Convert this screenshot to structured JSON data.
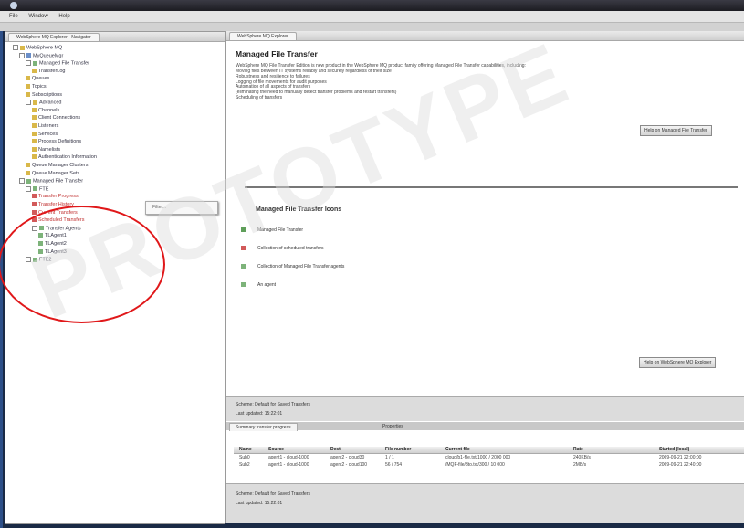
{
  "menu": [
    "File",
    "Window",
    "Help"
  ],
  "left_pane": {
    "tab": "WebSphere MQ Explorer - Navigator",
    "tree": [
      {
        "label": "WebSphere MQ",
        "depth": 0,
        "icon": "folder-icon",
        "expander": true
      },
      {
        "label": "MyQueueMgr",
        "depth": 1,
        "icon": "queue-manager-icon",
        "expander": true
      },
      {
        "label": "Managed File Transfer",
        "depth": 2,
        "icon": "agent-icon",
        "expander": true
      },
      {
        "label": "TransferLog",
        "depth": 3,
        "icon": "folder-icon"
      },
      {
        "label": "Queues",
        "depth": 2,
        "icon": "folder-icon"
      },
      {
        "label": "Topics",
        "depth": 2,
        "icon": "folder-icon"
      },
      {
        "label": "Subscriptions",
        "depth": 2,
        "icon": "folder-icon"
      },
      {
        "label": "Advanced",
        "depth": 2,
        "icon": "folder-icon",
        "expander": true
      },
      {
        "label": "Channels",
        "depth": 3,
        "icon": "folder-icon"
      },
      {
        "label": "Client Connections",
        "depth": 3,
        "icon": "folder-icon"
      },
      {
        "label": "Listeners",
        "depth": 3,
        "icon": "folder-icon"
      },
      {
        "label": "Services",
        "depth": 3,
        "icon": "folder-icon"
      },
      {
        "label": "Process Definitions",
        "depth": 3,
        "icon": "folder-icon"
      },
      {
        "label": "Namelists",
        "depth": 3,
        "icon": "folder-icon"
      },
      {
        "label": "Authentication Information",
        "depth": 3,
        "icon": "folder-icon"
      },
      {
        "label": "Queue Manager Clusters",
        "depth": 2,
        "icon": "folder-icon"
      },
      {
        "label": "Queue Manager Sets",
        "depth": 2,
        "icon": "folder-icon"
      },
      {
        "label": "Managed File Transfer",
        "depth": 1,
        "icon": "agent-icon",
        "expander": true
      },
      {
        "label": "FTE",
        "depth": 2,
        "icon": "agent-icon",
        "expander": true
      },
      {
        "label": "Transfer Progress",
        "depth": 3,
        "icon": "red-status-icon",
        "red": true
      },
      {
        "label": "Transfer History",
        "depth": 3,
        "icon": "red-status-icon",
        "red": true
      },
      {
        "label": "Current Transfers",
        "depth": 3,
        "icon": "red-status-icon",
        "red": true
      },
      {
        "label": "Scheduled Transfers",
        "depth": 3,
        "icon": "red-status-icon",
        "red": true
      },
      {
        "label": "Transfer Agents",
        "depth": 3,
        "icon": "agent-icon",
        "expander": true
      },
      {
        "label": "TLAgent1",
        "depth": 4,
        "icon": "agent-icon"
      },
      {
        "label": "TLAgent2",
        "depth": 4,
        "icon": "agent-icon"
      },
      {
        "label": "TLAgent3",
        "depth": 4,
        "icon": "agent-icon"
      },
      {
        "label": "FTE2",
        "depth": 2,
        "icon": "agent-icon",
        "expander": true
      }
    ],
    "popup_text": "Filter..."
  },
  "right_pane": {
    "tab": "WebSphere MQ Explorer",
    "title": "Managed File Transfer",
    "intro": "WebSphere MQ File Transfer Edition is new product in the WebSphere MQ product family offering Managed File Transfer capabilities, including:",
    "bullets": [
      "Moving files between IT systems reliably and securely regardless of their size",
      "Robustness and resilience to failures",
      "Logging of file movements for audit purposes",
      "Automation of all aspects of transfers",
      "(eliminating the need to manually detect transfer problems and restart transfers)",
      "Scheduling of transfers"
    ],
    "help_button_1": "Help on Managed File Transfer",
    "icons_title": "Managed File Transfer Icons",
    "legend": [
      {
        "label": "Managed File Transfer",
        "icon": "mft-icon",
        "color": "#5f9f5a"
      },
      {
        "label": "Collection of scheduled transfers",
        "icon": "schedule-icon",
        "color": "#d25a5a"
      },
      {
        "label": "Collection of Managed File Transfer agents",
        "icon": "agents-icon",
        "color": "#7db37a"
      },
      {
        "label": "An agent",
        "icon": "agent-icon",
        "color": "#7db37a"
      }
    ],
    "help_button_2": "Help on WebSphere MQ Explorer",
    "status_top": {
      "line1": "Scheme: Default for Saved Transfers",
      "line2": "Last updated: 15:22:01"
    },
    "bottom_tabs": [
      "Summary transfer progress",
      "Properties"
    ],
    "table": {
      "columns": [
        "Name",
        "Source",
        "Dest",
        "File number",
        "Current file",
        "Rate",
        "Started (local)"
      ],
      "rows": [
        [
          "Sub0",
          "agent1 - cloud-1000",
          "agent2 - cloud30",
          "1 / 1",
          "cloud/b1-file.txt/1000 / 2000 000",
          "240KB/s",
          "2009-09-21 22:00:00"
        ],
        [
          "Sub2",
          "agent1 - cloud-1000",
          "agent2 - cloud100",
          "56 / 754",
          "/MQF-file/3to.txt/300 / 10 000",
          "2MB/s",
          "2009-09-21 22:40:00"
        ]
      ]
    },
    "status_bottom": {
      "line1": "Scheme: Default for Saved Transfers",
      "line2": "Last updated: 15:22:01"
    }
  },
  "watermark": "PROTOTYPE"
}
